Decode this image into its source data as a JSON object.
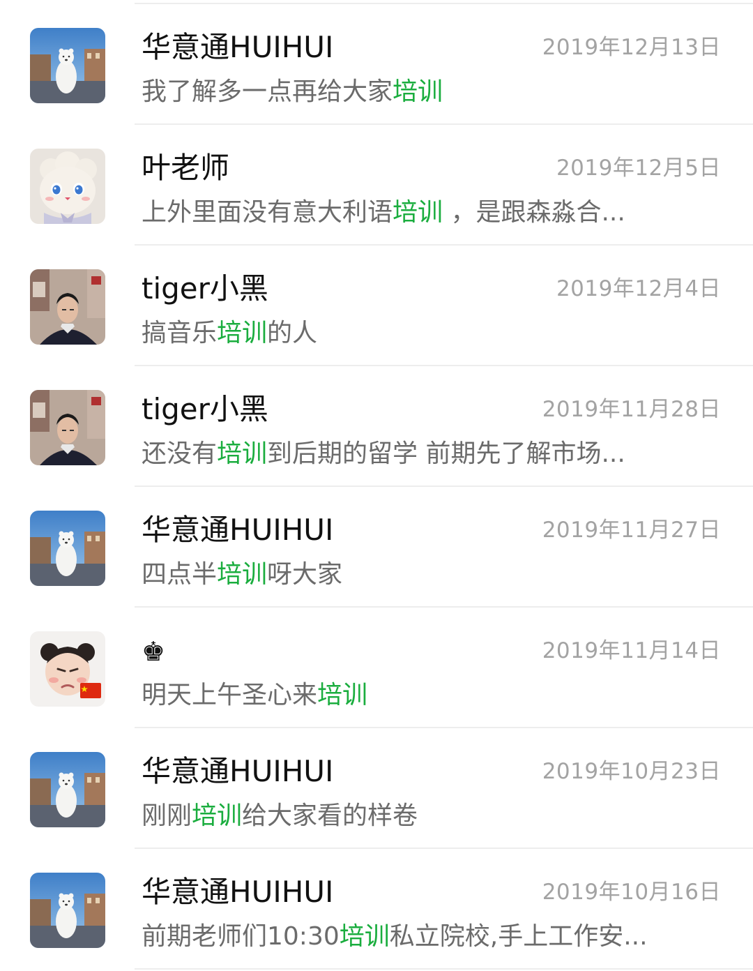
{
  "keyword": "培训",
  "accent_color": "#1aad3e",
  "items": [
    {
      "avatar": "polar-bear-avatar",
      "name": "华意通HUIHUI",
      "date": "2019年12月13日",
      "preview": {
        "before": "我了解多一点再给大家",
        "keyword": "培训",
        "after": ""
      }
    },
    {
      "avatar": "plush-lamb-avatar",
      "name": "叶老师",
      "date": "2019年12月5日",
      "preview": {
        "before": "上外里面没有意大利语",
        "keyword": "培训",
        "after": " ，是跟森淼合..."
      }
    },
    {
      "avatar": "young-man-avatar",
      "name": "tiger小黑",
      "date": "2019年12月4日",
      "preview": {
        "before": "搞音乐",
        "keyword": "培训",
        "after": "的人"
      }
    },
    {
      "avatar": "young-man-avatar",
      "name": "tiger小黑",
      "date": "2019年11月28日",
      "preview": {
        "before": "还没有",
        "keyword": "培训",
        "after": "到后期的留学 前期先了解市场..."
      }
    },
    {
      "avatar": "polar-bear-avatar",
      "name": "华意通HUIHUI",
      "date": "2019年11月27日",
      "preview": {
        "before": "四点半",
        "keyword": "培训",
        "after": "呀大家"
      }
    },
    {
      "avatar": "baby-avatar",
      "name": "♚",
      "date": "2019年11月14日",
      "preview": {
        "before": "明天上午圣心来",
        "keyword": "培训",
        "after": ""
      }
    },
    {
      "avatar": "polar-bear-avatar",
      "name": "华意通HUIHUI",
      "date": "2019年10月23日",
      "preview": {
        "before": "刚刚",
        "keyword": "培训",
        "after": "给大家看的样卷"
      }
    },
    {
      "avatar": "polar-bear-avatar",
      "name": "华意通HUIHUI",
      "date": "2019年10月16日",
      "preview": {
        "before": "前期老师们10:30",
        "keyword": "培训",
        "after": "私立院校,手上工作安..."
      }
    }
  ]
}
